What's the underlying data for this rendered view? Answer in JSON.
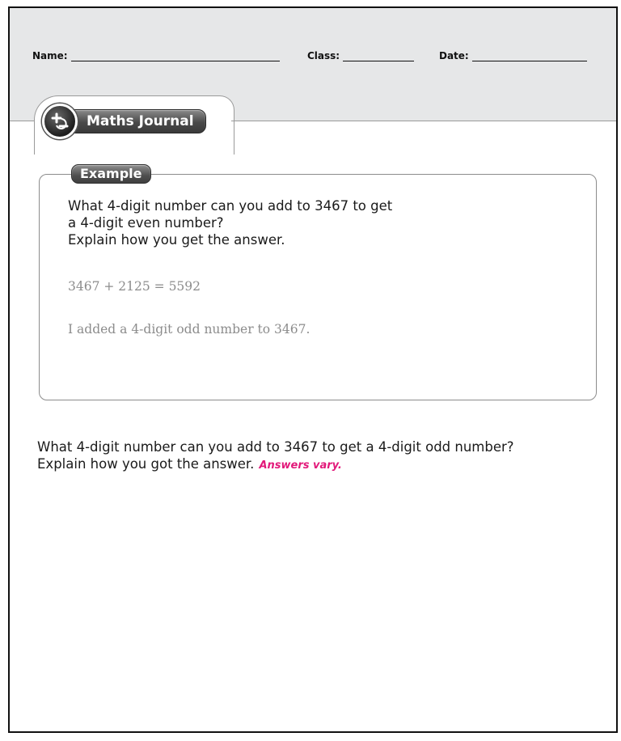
{
  "header": {
    "name_label": "Name:",
    "class_label": "Class:",
    "date_label": "Date:"
  },
  "section": {
    "title": "Maths Journal",
    "icon": "plus-minus-circle-icon"
  },
  "example": {
    "badge": "Example",
    "question_lines": [
      "What 4-digit number can you add to 3467 to get",
      "a 4-digit even number?",
      "Explain how you get the answer."
    ],
    "answer_equation": "3467 + 2125 = 5592",
    "answer_explanation": "I added a 4-digit odd number to 3467."
  },
  "question": {
    "lines": [
      "What 4-digit number can you add to 3467 to get a 4-digit odd number?",
      "Explain how you got the answer."
    ],
    "answer_note": "Answers vary."
  },
  "colors": {
    "header_band": "#e6e7e8",
    "answer_gray": "#8c8c8c",
    "answer_pink": "#e2197a"
  }
}
